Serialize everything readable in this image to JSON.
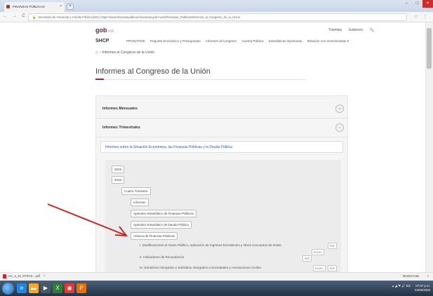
{
  "browser": {
    "tab_title": "FINANZAS PÚBLICAS",
    "tab_close": "×",
    "new_tab": "+",
    "window_controls": [
      "–",
      "□",
      "×"
    ],
    "url": "Secretaría de Hacienda y Crédito Público [MX] | https://www.finanzaspublicas.hacienda.gob.mx/es/Finanzas_Publicas/Informes_al_Congreso_de_la_Union",
    "nav_icons": "← → C ⌂"
  },
  "site": {
    "logo": "gob",
    "logo_suffix": ".mx",
    "top_links": [
      "Trámites",
      "Gobierno",
      "🔍"
    ],
    "brand": "SHCP",
    "nav_items": [
      "PRONAFIDE",
      "Paquete Económico y Presupuesto",
      "Informes al Congreso",
      "Cuenta Pública",
      "Estadísticas Oportunas",
      "Relación con Inversionistas ▾"
    ],
    "breadcrumb": "› Informes al Congreso de la Unión",
    "page_title": "Informes al Congreso de la Unión"
  },
  "accordion": [
    {
      "label": "Informes Mensuales",
      "toggle": "+"
    },
    {
      "label": "Informes Trimestrales",
      "toggle": "−"
    }
  ],
  "subheading": "Informes sobre la Situación Económica, las Finanzas Públicas y la Deuda Pública",
  "years": [
    "2019",
    "2018"
  ],
  "quarter": "Cuarto Trimestre",
  "items": [
    "Informes",
    "Apéndice Estadístico de Finanzas Públicas",
    "Apéndice Estadístico de Deuda Pública",
    "Anexos de Finanzas Públicas"
  ],
  "documents": [
    {
      "label": "I. Modificaciones al Gasto Público, Aplicación de Ingresos Excedentes y Otros Conceptos de Gasto",
      "formats": [
        "PDF"
      ]
    },
    {
      "label": "II. Indicadores de Recaudación",
      "formats": [
        "EXCEL",
        "PDF"
      ]
    },
    {
      "label": "III. Donativos Otorgados y Subsidios Otorgados a Sociedades y Asociaciones Civiles",
      "formats": [
        "EXCEL",
        "PDF"
      ]
    }
  ],
  "download_bar": {
    "file": "IAc_4_19_OTRAS....pdf",
    "chevron": "^",
    "show_all": "Mostrar todo",
    "close": "×"
  },
  "taskbar": {
    "time": "07:07 p.m.",
    "date": "04/06/2020",
    "tray": "▴ ◢ ⚑ 🔊 ES"
  },
  "colors": {
    "brand": "#6d2032",
    "accent": "#9d2449",
    "link": "#3c5a98",
    "arrow": "#c62828"
  }
}
